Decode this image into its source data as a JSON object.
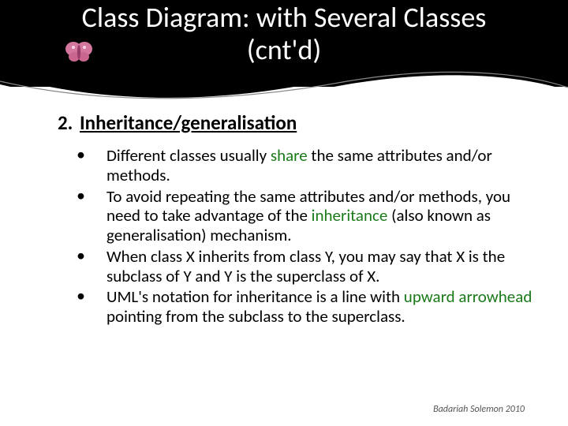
{
  "title_line1": "Class Diagram: with Several Classes",
  "title_line2": "(cnt'd)",
  "heading_num": "2.",
  "heading_text": "Inheritance/generalisation",
  "bullets": [
    {
      "pre": "Different classes usually ",
      "g": "share",
      "post": " the same attributes and/or methods."
    },
    {
      "pre": "To avoid repeating the same attributes and/or methods, you need to take advantage of the ",
      "g": "inheritance",
      "post": " (also known as generalisation) mechanism."
    },
    {
      "pre": "When class X inherits from class Y, you may say that X is the subclass of Y and Y is the superclass of X.",
      "g": "",
      "post": ""
    },
    {
      "pre": "UML's notation for inheritance is a line with ",
      "g": "upward arrowhead",
      "post": " pointing from the subclass to the superclass."
    }
  ],
  "footer": "Badariah Solemon 2010"
}
